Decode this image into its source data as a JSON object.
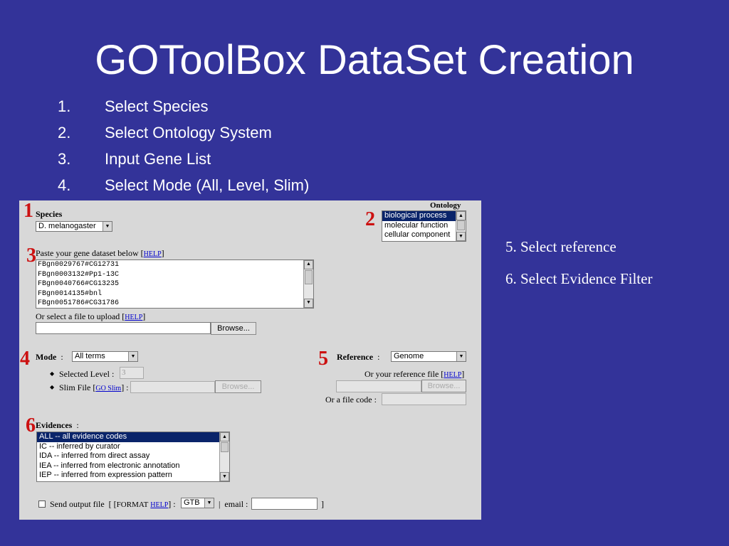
{
  "slide": {
    "title": "GOToolBox DataSet Creation",
    "steps": [
      {
        "num": "1.",
        "text": "Select Species"
      },
      {
        "num": "2.",
        "text": "Select Ontology System"
      },
      {
        "num": "3.",
        "text": "Input Gene List"
      },
      {
        "num": "4.",
        "text": "Select Mode (All, Level, Slim)"
      }
    ],
    "notes": [
      "5. Select reference",
      "6. Select Evidence Filter"
    ],
    "badges": [
      "1",
      "2",
      "3",
      "4",
      "5",
      "6"
    ]
  },
  "form": {
    "species": {
      "label": "Species",
      "value": "D. melanogaster"
    },
    "ontology": {
      "label": "Ontology",
      "options": [
        "biological process",
        "molecular function",
        "cellular component"
      ],
      "selected_index": 0
    },
    "gene_list": {
      "label": "Paste your gene dataset below",
      "help": "HELP",
      "lines": [
        "FBgn0029767#CG12731",
        "FBgn0003132#Pp1-13C",
        "FBgn0040766#CG13235",
        "FBgn0014135#bnl",
        "FBgn0051786#CG31786"
      ]
    },
    "upload": {
      "label": "Or select a file to upload",
      "help": "HELP",
      "browse": "Browse..."
    },
    "mode": {
      "label": "Mode",
      "value": "All terms",
      "level_label": "Selected Level :",
      "level_value": "3",
      "slim_label": "Slim File",
      "slim_link": "GO Slim",
      "browse": "Browse..."
    },
    "reference": {
      "label": "Reference",
      "value": "Genome",
      "file_label": "Or your reference file",
      "help": "HELP",
      "browse": "Browse...",
      "code_label": "Or a file code :"
    },
    "evidences": {
      "label": "Evidences",
      "options": [
        "ALL -- all evidence codes",
        "IC -- inferred by curator",
        "IDA -- inferred from direct assay",
        "IEA -- inferred from electronic annotation",
        "IEP -- inferred from expression pattern"
      ],
      "selected_index": 0
    },
    "output": {
      "send_label": "Send output file",
      "format_label": "FORMAT",
      "help": "HELP",
      "format_value": "GTB",
      "email_label": "email :"
    }
  }
}
